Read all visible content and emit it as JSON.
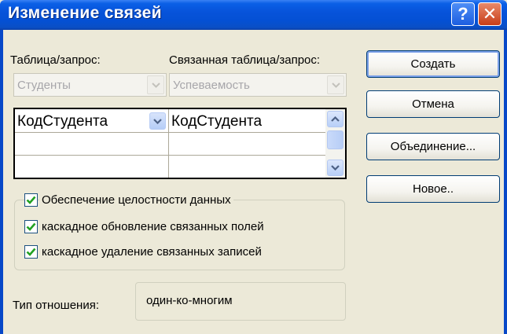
{
  "window": {
    "title": "Изменение связей",
    "help_label": "?",
    "close_label": "✕"
  },
  "left": {
    "label": "Таблица/запрос:",
    "combo_value": "Студенты"
  },
  "right": {
    "label": "Связанная таблица/запрос:",
    "combo_value": "Успеваемость"
  },
  "grid": {
    "rows": [
      {
        "left": "КодСтудента",
        "right": "КодСтудента"
      },
      {
        "left": "",
        "right": ""
      },
      {
        "left": "",
        "right": ""
      }
    ]
  },
  "options": {
    "integrity": {
      "label": "Обеспечение целостности данных",
      "checked": true
    },
    "cascade_update": {
      "label": "каскадное обновление связанных полей",
      "checked": true
    },
    "cascade_delete": {
      "label": "каскадное удаление связанных записей",
      "checked": true
    }
  },
  "relation": {
    "label": "Тип отношения:",
    "value": "один-ко-многим"
  },
  "buttons": {
    "create": "Создать",
    "cancel": "Отмена",
    "join": "Объединение...",
    "new": "Новое.."
  },
  "colors": {
    "titlebar": "#0753DA",
    "dialog_bg": "#ECE9D8",
    "check_mark": "#21A121",
    "close_button": "#C83D18"
  }
}
